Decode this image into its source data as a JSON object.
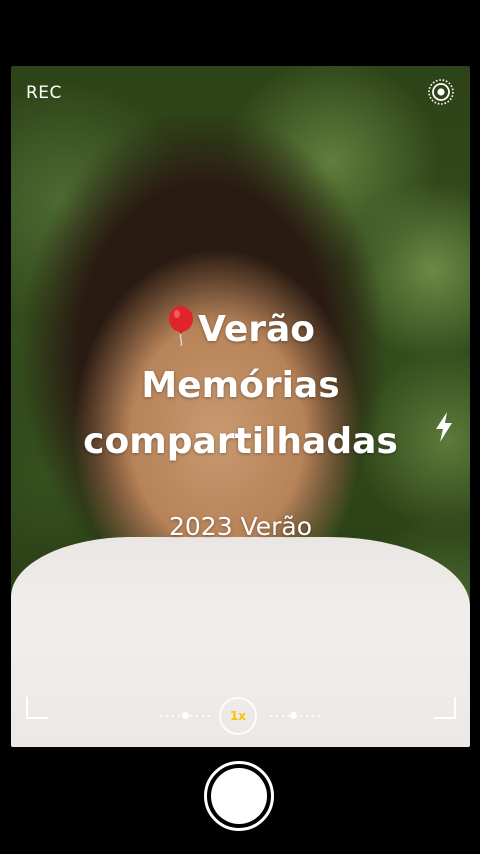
{
  "status": {
    "rec_label": "REC"
  },
  "overlay": {
    "title_lines": [
      "Verão",
      "Memórias",
      "compartilhadas"
    ],
    "balloon_emoji": "🎈",
    "subtitle": "2023 Verão"
  },
  "zoom": {
    "label": "1x",
    "accent_color": "#f5c400"
  },
  "icons": {
    "settings": "live-photo-icon",
    "flash": "flash-icon",
    "balloon": "balloon-icon"
  },
  "colors": {
    "background": "#000000",
    "text": "#ffffff"
  }
}
